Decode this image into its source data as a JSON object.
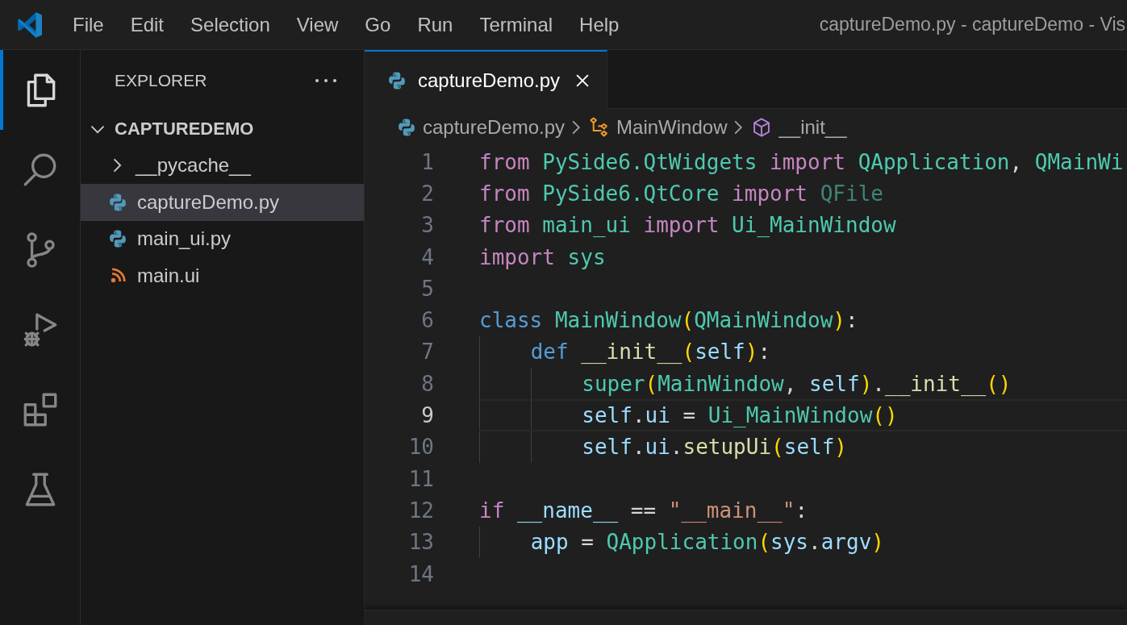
{
  "window": {
    "title": "captureDemo.py - captureDemo - Vis"
  },
  "menu": [
    {
      "label": "File"
    },
    {
      "label": "Edit"
    },
    {
      "label": "Selection"
    },
    {
      "label": "View"
    },
    {
      "label": "Go"
    },
    {
      "label": "Run"
    },
    {
      "label": "Terminal"
    },
    {
      "label": "Help"
    }
  ],
  "activity_bar": [
    {
      "kind": "explorer",
      "selected": true
    },
    {
      "kind": "search",
      "selected": false
    },
    {
      "kind": "source-control",
      "selected": false
    },
    {
      "kind": "run-debug",
      "selected": false
    },
    {
      "kind": "extensions",
      "selected": false
    },
    {
      "kind": "testing",
      "selected": false
    }
  ],
  "sidebar": {
    "title": "EXPLORER",
    "folder": {
      "name": "CAPTUREDEMO",
      "expanded": true,
      "children": [
        {
          "name": "__pycache__",
          "kind": "folder",
          "expanded": false,
          "selected": false
        },
        {
          "name": "captureDemo.py",
          "kind": "python",
          "selected": true
        },
        {
          "name": "main_ui.py",
          "kind": "python",
          "selected": false
        },
        {
          "name": "main.ui",
          "kind": "feed",
          "selected": false
        }
      ]
    }
  },
  "tabs": [
    {
      "label": "captureDemo.py",
      "kind": "python",
      "selected": true
    }
  ],
  "breadcrumbs": [
    {
      "label": "captureDemo.py",
      "kind": "python"
    },
    {
      "label": "MainWindow",
      "kind": "class"
    },
    {
      "label": "__init__",
      "kind": "method"
    }
  ],
  "code": [
    {
      "number": "1",
      "current": false,
      "tokens": [
        {
          "kind": "keyword",
          "text": "from "
        },
        {
          "kind": "type",
          "text": "PySide6.QtWidgets "
        },
        {
          "kind": "keyword",
          "text": "import "
        },
        {
          "kind": "type",
          "text": "QApplication"
        },
        {
          "kind": "plain",
          "text": ", "
        },
        {
          "kind": "type",
          "text": "QMainWi"
        }
      ]
    },
    {
      "number": "2",
      "current": false,
      "tokens": [
        {
          "kind": "keyword",
          "text": "from "
        },
        {
          "kind": "type",
          "text": "PySide6.QtCore "
        },
        {
          "kind": "keyword",
          "text": "import "
        },
        {
          "kind": "unused",
          "text": "QFile"
        }
      ]
    },
    {
      "number": "3",
      "current": false,
      "tokens": [
        {
          "kind": "keyword",
          "text": "from "
        },
        {
          "kind": "type",
          "text": "main_ui "
        },
        {
          "kind": "keyword",
          "text": "import "
        },
        {
          "kind": "type",
          "text": "Ui_MainWindow"
        }
      ]
    },
    {
      "number": "4",
      "current": false,
      "tokens": [
        {
          "kind": "keyword",
          "text": "import "
        },
        {
          "kind": "type",
          "text": "sys"
        }
      ]
    },
    {
      "number": "5",
      "current": false
    },
    {
      "number": "6",
      "current": false,
      "tokens": [
        {
          "kind": "storage",
          "text": "class "
        },
        {
          "kind": "type",
          "text": "MainWindow"
        },
        {
          "kind": "bracket",
          "text": "("
        },
        {
          "kind": "type",
          "text": "QMainWindow"
        },
        {
          "kind": "bracket",
          "text": ")"
        },
        {
          "kind": "plain",
          "text": ":"
        }
      ]
    },
    {
      "number": "7",
      "current": false,
      "tokens": [
        {
          "kind": "storage",
          "text": "    def "
        },
        {
          "kind": "function",
          "text": "__init__"
        },
        {
          "kind": "bracket",
          "text": "("
        },
        {
          "kind": "variable",
          "text": "self"
        },
        {
          "kind": "bracket",
          "text": ")"
        },
        {
          "kind": "plain",
          "text": ":"
        }
      ]
    },
    {
      "number": "8",
      "current": false,
      "tokens": [
        {
          "kind": "type",
          "text": "        super"
        },
        {
          "kind": "bracket",
          "text": "("
        },
        {
          "kind": "type",
          "text": "MainWindow"
        },
        {
          "kind": "plain",
          "text": ", "
        },
        {
          "kind": "variable",
          "text": "self"
        },
        {
          "kind": "bracket",
          "text": ")"
        },
        {
          "kind": "plain",
          "text": "."
        },
        {
          "kind": "function",
          "text": "__init__"
        },
        {
          "kind": "bracket",
          "text": "()"
        }
      ]
    },
    {
      "number": "9",
      "current": true,
      "tokens": [
        {
          "kind": "variable",
          "text": "        self"
        },
        {
          "kind": "plain",
          "text": "."
        },
        {
          "kind": "variable",
          "text": "ui "
        },
        {
          "kind": "plain",
          "text": "= "
        },
        {
          "kind": "type",
          "text": "Ui_MainWindow"
        },
        {
          "kind": "bracket",
          "text": "()"
        }
      ]
    },
    {
      "number": "10",
      "current": false,
      "tokens": [
        {
          "kind": "variable",
          "text": "        self"
        },
        {
          "kind": "plain",
          "text": "."
        },
        {
          "kind": "variable",
          "text": "ui"
        },
        {
          "kind": "plain",
          "text": "."
        },
        {
          "kind": "function",
          "text": "setupUi"
        },
        {
          "kind": "bracket",
          "text": "("
        },
        {
          "kind": "variable",
          "text": "self"
        },
        {
          "kind": "bracket",
          "text": ")"
        }
      ]
    },
    {
      "number": "11",
      "current": false
    },
    {
      "number": "12",
      "current": false,
      "tokens": [
        {
          "kind": "keyword",
          "text": "if "
        },
        {
          "kind": "variable",
          "text": "__name__ "
        },
        {
          "kind": "plain",
          "text": "== "
        },
        {
          "kind": "string",
          "text": "\"__main__\""
        },
        {
          "kind": "plain",
          "text": ":"
        }
      ]
    },
    {
      "number": "13",
      "current": false,
      "tokens": [
        {
          "kind": "variable",
          "text": "    app "
        },
        {
          "kind": "plain",
          "text": "= "
        },
        {
          "kind": "type",
          "text": "QApplication"
        },
        {
          "kind": "bracket",
          "text": "("
        },
        {
          "kind": "variable",
          "text": "sys"
        },
        {
          "kind": "plain",
          "text": "."
        },
        {
          "kind": "variable",
          "text": "argv"
        },
        {
          "kind": "bracket",
          "text": ")"
        }
      ]
    },
    {
      "number": "14",
      "current": false
    }
  ]
}
